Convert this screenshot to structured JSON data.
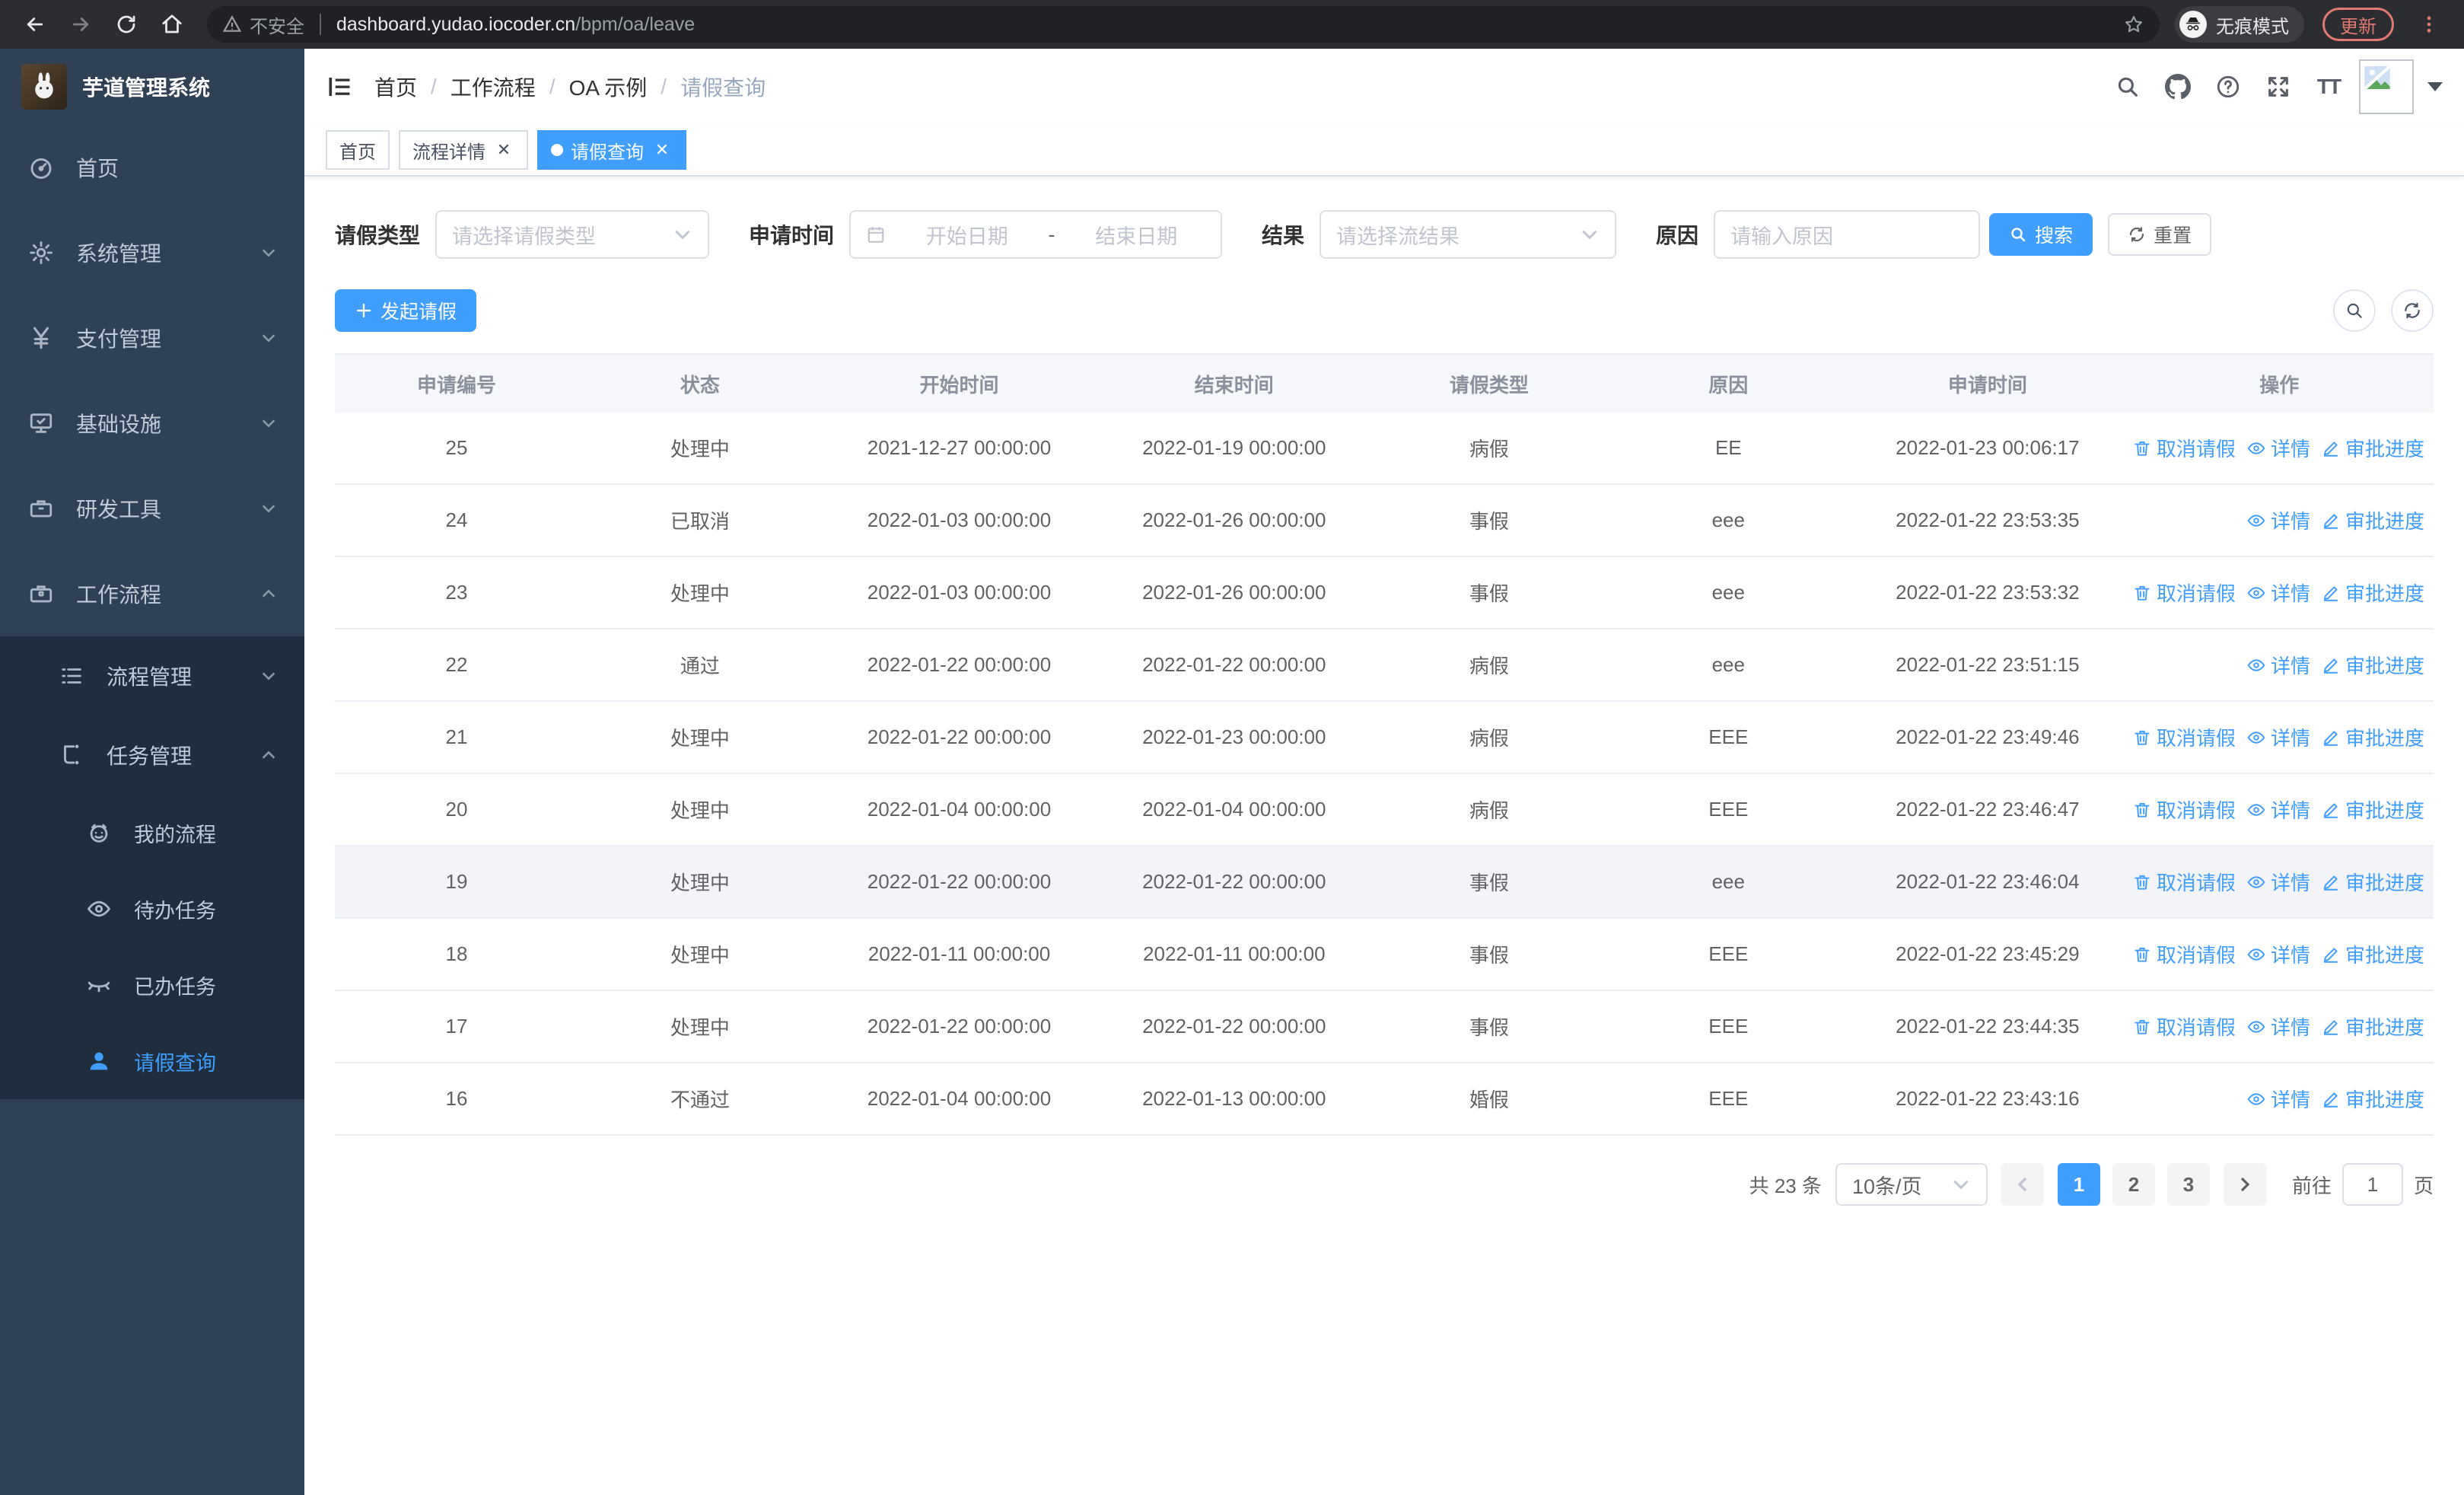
{
  "browser": {
    "security_label": "不安全",
    "url_host": "dashboard.yudao.iocoder.cn",
    "url_path": "/bpm/oa/leave",
    "incognito_label": "无痕模式",
    "update_label": "更新"
  },
  "sidebar": {
    "title": "芋道管理系统",
    "items": [
      {
        "label": "首页",
        "icon": "dashboard-icon"
      },
      {
        "label": "系统管理",
        "icon": "gear-icon"
      },
      {
        "label": "支付管理",
        "icon": "yen-icon"
      },
      {
        "label": "基础设施",
        "icon": "monitor-icon"
      },
      {
        "label": "研发工具",
        "icon": "toolbox-icon"
      },
      {
        "label": "工作流程",
        "icon": "briefcase-icon"
      }
    ],
    "workflow_children": [
      {
        "label": "流程管理",
        "icon": "list-icon"
      },
      {
        "label": "任务管理",
        "icon": "tree-icon"
      }
    ],
    "task_children": [
      {
        "label": "我的流程",
        "icon": "robot-icon"
      },
      {
        "label": "待办任务",
        "icon": "eye-icon"
      },
      {
        "label": "已办任务",
        "icon": "eye-off-icon"
      },
      {
        "label": "请假查询",
        "icon": "user-icon",
        "active": true
      }
    ]
  },
  "header": {
    "breadcrumb": [
      "首页",
      "工作流程",
      "OA 示例",
      "请假查询"
    ],
    "font_icon_label": "TT"
  },
  "tabs": [
    {
      "label": "首页",
      "closable": false,
      "active": false
    },
    {
      "label": "流程详情",
      "closable": true,
      "active": false
    },
    {
      "label": "请假查询",
      "closable": true,
      "active": true
    }
  ],
  "filters": {
    "leave_type_label": "请假类型",
    "leave_type_placeholder": "请选择请假类型",
    "apply_time_label": "申请时间",
    "start_date_placeholder": "开始日期",
    "range_separator": "-",
    "end_date_placeholder": "结束日期",
    "result_label": "结果",
    "result_placeholder": "请选择流结果",
    "reason_label": "原因",
    "reason_placeholder": "请输入原因",
    "search_label": "搜索",
    "reset_label": "重置"
  },
  "toolbar": {
    "create_label": "发起请假"
  },
  "table": {
    "columns": [
      "申请编号",
      "状态",
      "开始时间",
      "结束时间",
      "请假类型",
      "原因",
      "申请时间",
      "操作"
    ],
    "actions": {
      "cancel": "取消请假",
      "detail": "详情",
      "progress": "审批进度"
    },
    "rows": [
      {
        "id": "25",
        "status": "处理中",
        "start": "2021-12-27 00:00:00",
        "end": "2022-01-19 00:00:00",
        "type": "病假",
        "reason": "EE",
        "applied": "2022-01-23 00:06:17",
        "can_cancel": true,
        "highlight": false
      },
      {
        "id": "24",
        "status": "已取消",
        "start": "2022-01-03 00:00:00",
        "end": "2022-01-26 00:00:00",
        "type": "事假",
        "reason": "eee",
        "applied": "2022-01-22 23:53:35",
        "can_cancel": false,
        "highlight": false
      },
      {
        "id": "23",
        "status": "处理中",
        "start": "2022-01-03 00:00:00",
        "end": "2022-01-26 00:00:00",
        "type": "事假",
        "reason": "eee",
        "applied": "2022-01-22 23:53:32",
        "can_cancel": true,
        "highlight": false
      },
      {
        "id": "22",
        "status": "通过",
        "start": "2022-01-22 00:00:00",
        "end": "2022-01-22 00:00:00",
        "type": "病假",
        "reason": "eee",
        "applied": "2022-01-22 23:51:15",
        "can_cancel": false,
        "highlight": false
      },
      {
        "id": "21",
        "status": "处理中",
        "start": "2022-01-22 00:00:00",
        "end": "2022-01-23 00:00:00",
        "type": "病假",
        "reason": "EEE",
        "applied": "2022-01-22 23:49:46",
        "can_cancel": true,
        "highlight": false
      },
      {
        "id": "20",
        "status": "处理中",
        "start": "2022-01-04 00:00:00",
        "end": "2022-01-04 00:00:00",
        "type": "病假",
        "reason": "EEE",
        "applied": "2022-01-22 23:46:47",
        "can_cancel": true,
        "highlight": false
      },
      {
        "id": "19",
        "status": "处理中",
        "start": "2022-01-22 00:00:00",
        "end": "2022-01-22 00:00:00",
        "type": "事假",
        "reason": "eee",
        "applied": "2022-01-22 23:46:04",
        "can_cancel": true,
        "highlight": true
      },
      {
        "id": "18",
        "status": "处理中",
        "start": "2022-01-11 00:00:00",
        "end": "2022-01-11 00:00:00",
        "type": "事假",
        "reason": "EEE",
        "applied": "2022-01-22 23:45:29",
        "can_cancel": true,
        "highlight": false
      },
      {
        "id": "17",
        "status": "处理中",
        "start": "2022-01-22 00:00:00",
        "end": "2022-01-22 00:00:00",
        "type": "事假",
        "reason": "EEE",
        "applied": "2022-01-22 23:44:35",
        "can_cancel": true,
        "highlight": false
      },
      {
        "id": "16",
        "status": "不通过",
        "start": "2022-01-04 00:00:00",
        "end": "2022-01-13 00:00:00",
        "type": "婚假",
        "reason": "EEE",
        "applied": "2022-01-22 23:43:16",
        "can_cancel": false,
        "highlight": false
      }
    ]
  },
  "pagination": {
    "total_label": "共 23 条",
    "page_size_label": "10条/页",
    "pages": [
      "1",
      "2",
      "3"
    ],
    "active_page": "1",
    "goto_label": "前往",
    "goto_value": "1",
    "page_suffix": "页"
  },
  "colors": {
    "accent": "#409eff",
    "sidebar_bg": "#304156",
    "submenu_bg": "#1f2d3d",
    "update_accent": "#e0796f"
  }
}
